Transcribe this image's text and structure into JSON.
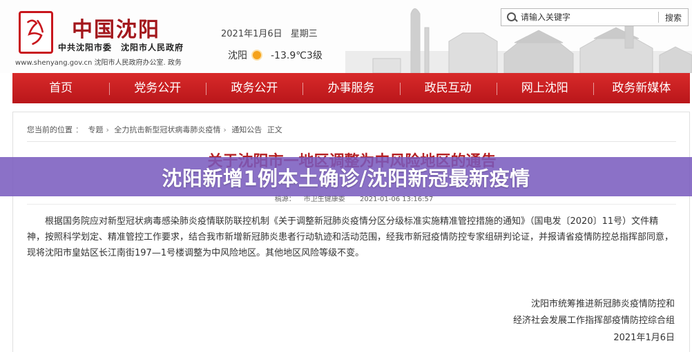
{
  "header": {
    "logo_text": "沈阳",
    "site_name": "中国沈阳",
    "sponsors": "中共沈阳市委　沈阳市人民政府",
    "url": "www.shenyang.gov.cn",
    "office": "沈阳市人民政府办公室. 政务",
    "date": "2021年1月6日",
    "weekday": "星期三",
    "city": "沈阳",
    "temperature": "-13.9℃3级"
  },
  "search": {
    "placeholder": "请输入关键字",
    "button_label": "搜索"
  },
  "nav": {
    "items": [
      "首页",
      "党务公开",
      "政务公开",
      "办事服务",
      "政民互动",
      "网上沈阳",
      "政务新媒体"
    ]
  },
  "breadcrumb": {
    "prefix": "您当前的位置",
    "items": [
      "专题",
      "全力抗击新型冠状病毒肺炎疫情",
      "通知公告",
      "正文"
    ]
  },
  "article": {
    "title": "关于沈阳市一地区调整为中风险地区的通告",
    "source_label": "稿源：",
    "source": "市卫生健康委",
    "published": "2021-01-06 13:16:57",
    "body": "根据国务院应对新型冠状病毒感染肺炎疫情联防联控机制《关于调整新冠肺炎疫情分区分级标准实施精准管控措施的通知》（国电发〔2020〕11号）文件精神，按照科学划定、精准管控工作要求，结合我市新增新冠肺炎患者行动轨迹和活动范围，经我市新冠疫情防控专家组研判论证，并报请省疫情防控总指挥部同意，现将沈阳市皇姑区长江南街197—1号楼调整为中风险地区。其他地区风险等级不变。",
    "signature_1": "沈阳市统筹推进新冠肺炎疫情防控和",
    "signature_2": "经济社会发展工作指挥部疫情防控综合组",
    "signature_date": "2021年1月6日"
  },
  "overlay": {
    "title": "沈阳新增1例本土确诊/沈阳新冠最新疫情",
    "color": "#785abe"
  },
  "colors": {
    "brand_red": "#c8161d",
    "nav_red": "#c91f22",
    "title_red": "#b52124"
  }
}
